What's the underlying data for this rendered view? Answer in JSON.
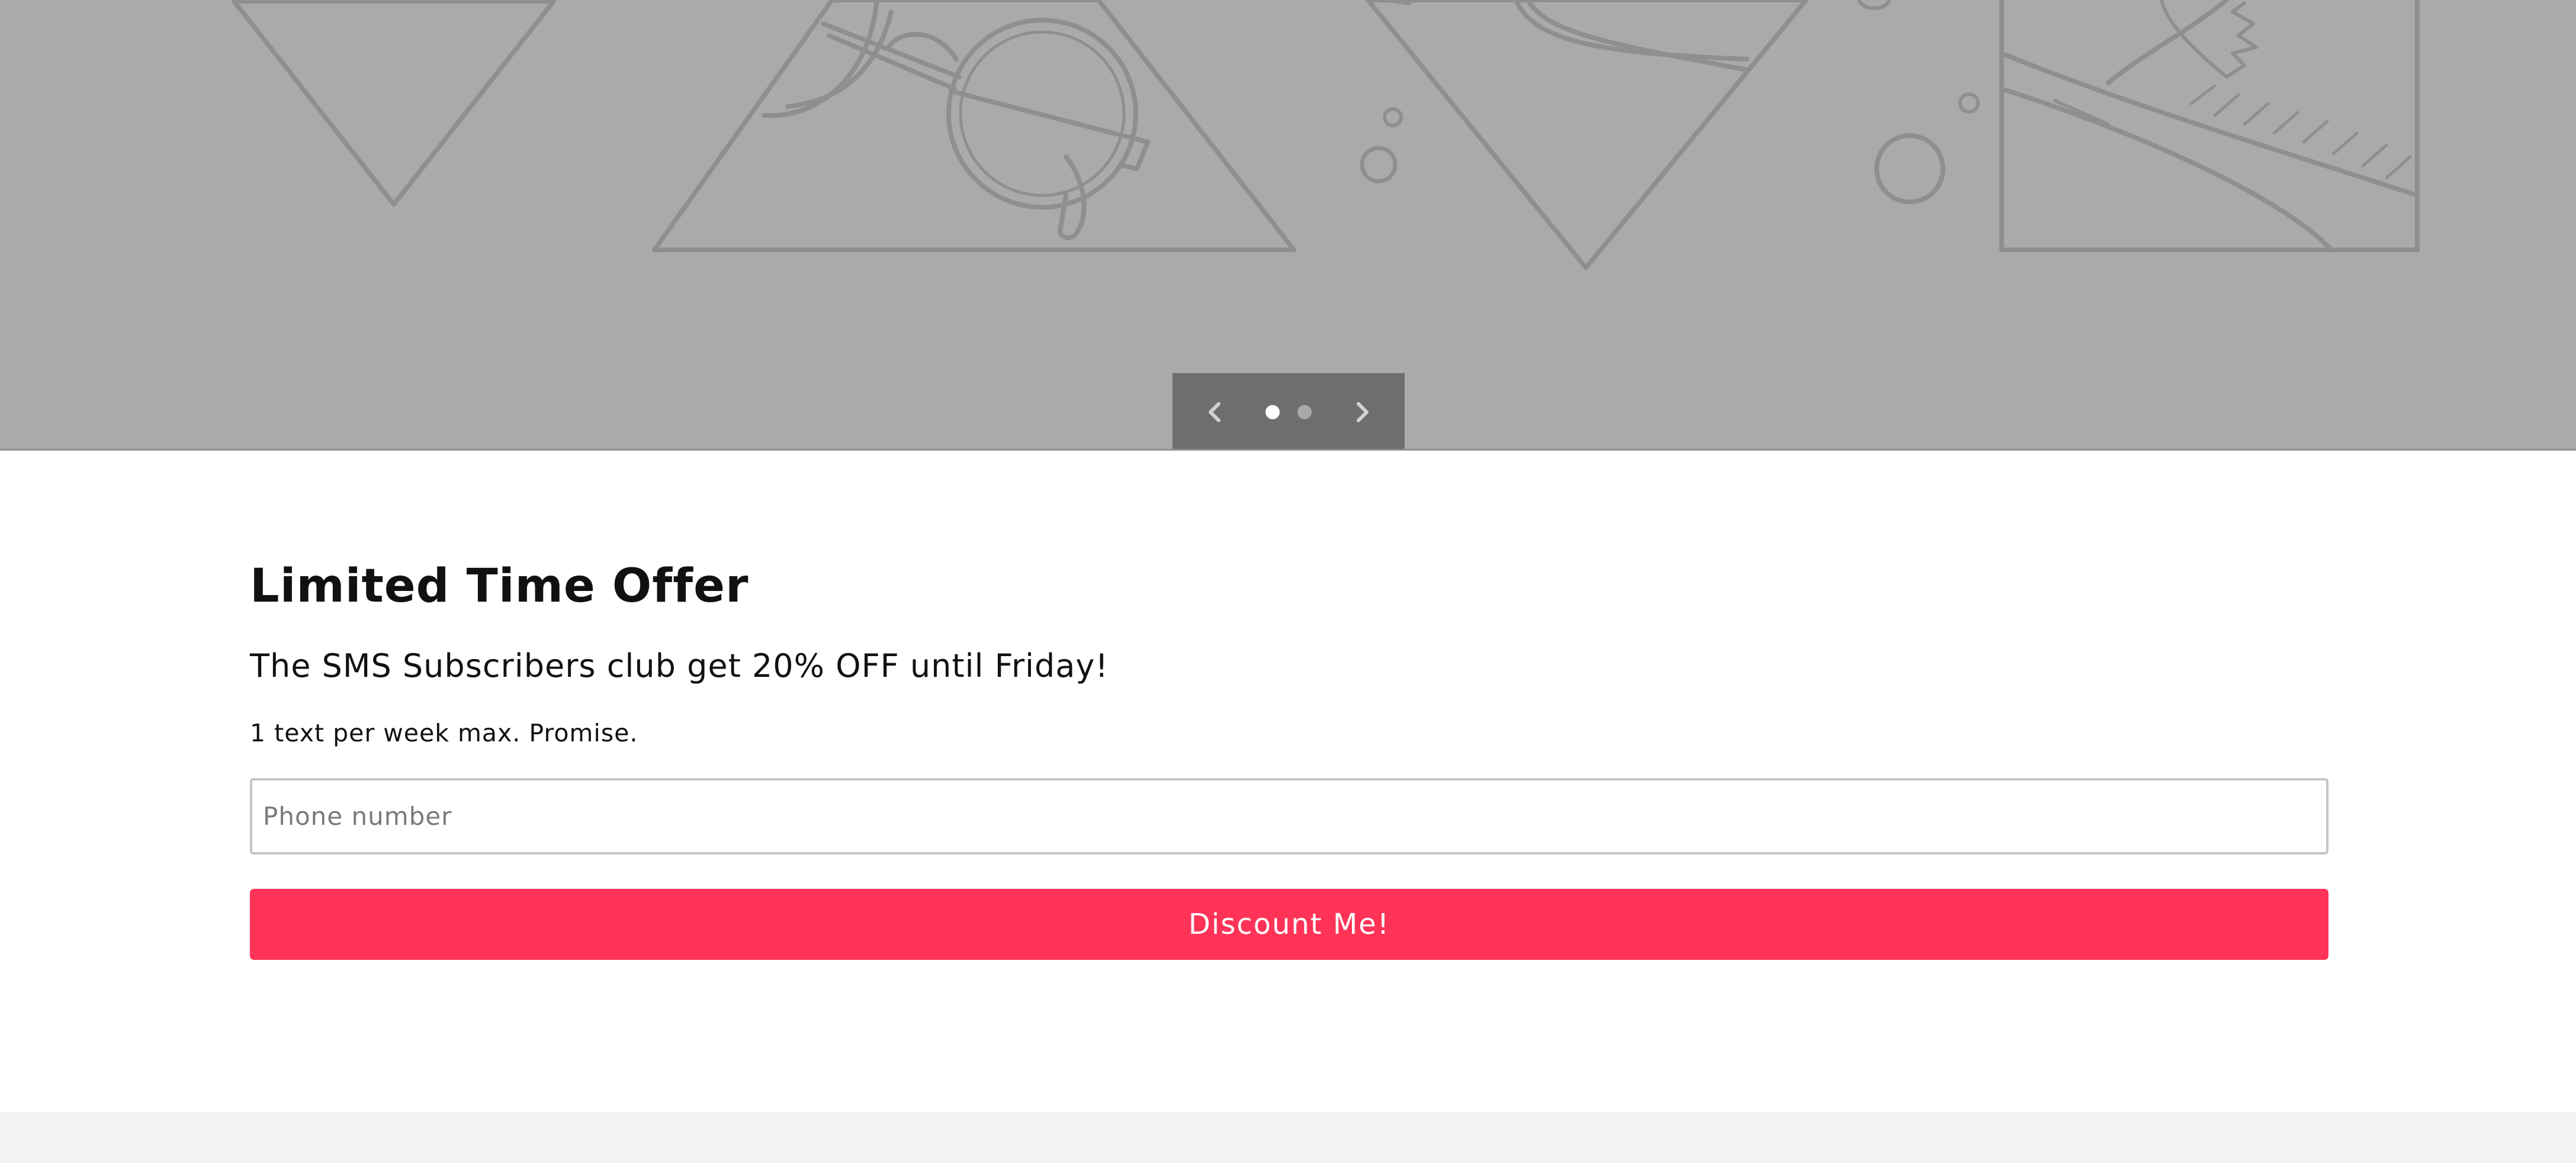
{
  "slideshow": {
    "prev_icon": "chevron-left-icon",
    "next_icon": "chevron-right-icon",
    "slide_count": 2,
    "active_slide": 1
  },
  "offer": {
    "title": "Limited Time Offer",
    "subtitle": "The SMS Subscribers club get 20% OFF until Friday!",
    "note": "1 text per week max. Promise.",
    "phone_placeholder": "Phone number",
    "phone_value": "",
    "button_label": "Discount Me!"
  },
  "colors": {
    "hero_background": "#a9aaac",
    "controls_background": "#6d6e70",
    "accent_button": "#ff3358",
    "footer_background": "#f3f3f3"
  }
}
